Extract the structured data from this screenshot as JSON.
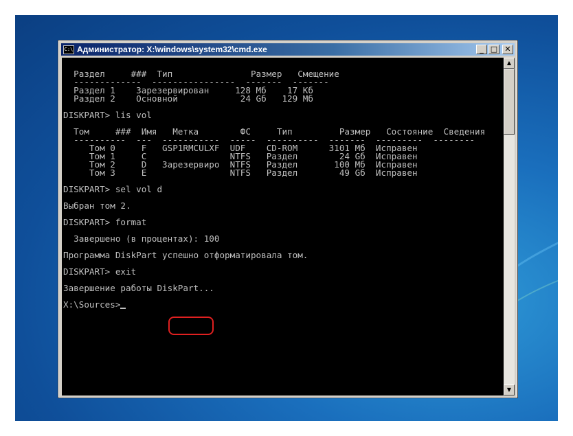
{
  "window": {
    "title": "Администратор: X:\\windows\\system32\\cmd.exe",
    "icon_label": "C:\\",
    "controls": {
      "minimize": "_",
      "maximize": "□",
      "close": "✕"
    }
  },
  "console": {
    "lines": [
      "",
      "  Раздел     ###  Тип               Размер   Смещение",
      "  -------------  ----------------  -------  -------",
      "  Раздел 1    Зарезервирован     128 Мб    17 Кб",
      "  Раздел 2    Основной            24 Gб   129 Мб",
      "",
      "DISKPART> lis vol",
      "",
      "  Том     ###  Имя   Метка        ФС     Тип         Размер   Состояние  Сведения",
      "  ----------  ---  -----------  -----  ----------  -------  ---------  --------",
      "     Том 0     F   GSP1RMCULXF  UDF    CD-ROM      3101 Мб  Исправен",
      "     Том 1     C                NTFS   Раздел        24 Gб  Исправен",
      "     Том 2     D   Зарезервиро  NTFS   Раздел       100 Мб  Исправен",
      "     Том 3     E                NTFS   Раздел        49 Gб  Исправен",
      "",
      "DISKPART> sel vol d",
      "",
      "Выбран том 2.",
      "",
      "DISKPART> format",
      "",
      "  Завершено (в процентах): 100",
      "",
      "Программа DiskPart успешно отформатировала том.",
      "",
      "DISKPART> exit",
      "",
      "Завершение работы DiskPart...",
      "",
      "X:\\Sources>"
    ]
  },
  "scrollbar": {
    "up": "▲",
    "down": "▼"
  }
}
